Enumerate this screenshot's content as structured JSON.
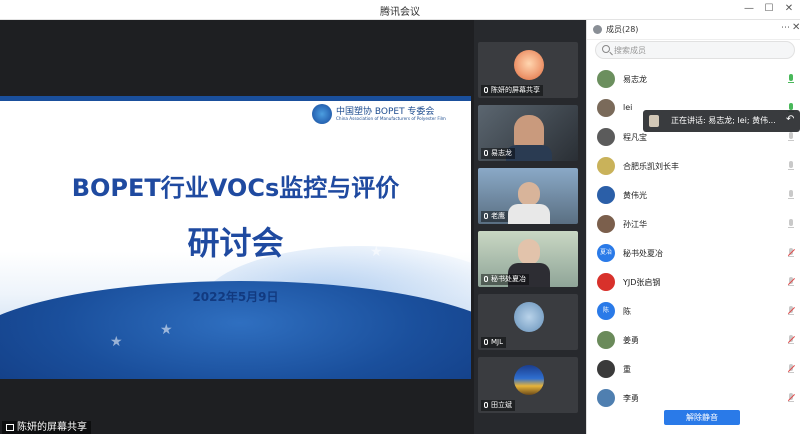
{
  "window": {
    "title": "腾讯会议"
  },
  "shared_screen": {
    "slide": {
      "org_name_cn": "中国塑协 BOPET 专委会",
      "org_name_en": "China Association of Manufacturers of Polyester Film",
      "title": "BOPET行业VOCs监控与评价",
      "subtitle": "研讨会",
      "date": "2022年5月9日"
    },
    "presenter_label": "陈妍的屏幕共享"
  },
  "video_tiles": [
    {
      "name": "陈妍的屏幕共享",
      "kind": "avatar"
    },
    {
      "name": "易志龙",
      "kind": "video"
    },
    {
      "name": "老鹰",
      "kind": "video"
    },
    {
      "name": "秘书处夏冶",
      "kind": "video"
    },
    {
      "name": "MJL",
      "kind": "avatar"
    },
    {
      "name": "田立斌",
      "kind": "avatar"
    }
  ],
  "members_panel": {
    "title": "成员(28)",
    "search_placeholder": "搜索成员",
    "members": [
      {
        "name": "易志龙",
        "mic": "on",
        "avatar_color": "#6b8f5e"
      },
      {
        "name": "lei",
        "mic": "on",
        "avatar_color": "#7a6a5a"
      },
      {
        "name": "程凡宝",
        "mic": "off",
        "avatar_color": "#5b5b5b"
      },
      {
        "name": "合肥乐凯刘长丰",
        "mic": "off",
        "avatar_color": "#c9b25a"
      },
      {
        "name": "黄伟光",
        "mic": "off",
        "avatar_color": "#2b5fa8"
      },
      {
        "name": "孙江华",
        "mic": "off",
        "avatar_color": "#7b5f4c"
      },
      {
        "name": "秘书处夏冶",
        "mic": "muted",
        "avatar_color": "#2a7ae8",
        "avatar_text": "夏冶"
      },
      {
        "name": "YJD张启钢",
        "mic": "muted",
        "avatar_color": "#d8312b"
      },
      {
        "name": "陈",
        "mic": "muted",
        "avatar_color": "#2a7ae8",
        "avatar_text": "陈"
      },
      {
        "name": "姜勇",
        "mic": "muted",
        "avatar_color": "#6a8a5a"
      },
      {
        "name": "重",
        "mic": "muted",
        "avatar_color": "#3a3a3a"
      },
      {
        "name": "李勇",
        "mic": "muted",
        "avatar_color": "#4f7fb0"
      }
    ],
    "unmute_all_label": "解除静音"
  },
  "speaking_banner": {
    "text": "正在讲话: 易志龙; lei; 黄伟..."
  },
  "colors": {
    "accent": "#2a7ae8",
    "mic_on": "#49b85a",
    "muted": "#e04b4b"
  }
}
